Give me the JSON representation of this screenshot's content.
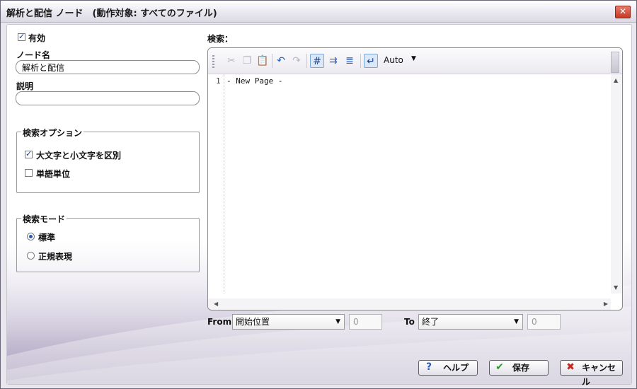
{
  "window": {
    "title": "解析と配信 ノード　(動作対象: すべてのファイル)"
  },
  "left": {
    "enabled_label": "有効",
    "node_name_label": "ノード名",
    "node_name_value": "解析と配信",
    "description_label": "説明",
    "description_value": "",
    "search_options": {
      "legend": "検索オプション",
      "case_label": "大文字と小文字を区別",
      "word_label": "単語単位"
    },
    "search_mode": {
      "legend": "検索モード",
      "standard_label": "標準",
      "regex_label": "正規表現"
    }
  },
  "search": {
    "label": "検索：",
    "toolbar": {
      "wrap_mode": "Auto"
    },
    "editor": {
      "line_number": "1",
      "content": "- New Page -"
    }
  },
  "range": {
    "from_label": "From",
    "from_select": "開始位置",
    "from_value": "0",
    "to_label": "To",
    "to_select": "終了",
    "to_value": "0"
  },
  "buttons": {
    "help": "ヘルプ",
    "save": "保存",
    "cancel": "キャンセル"
  }
}
